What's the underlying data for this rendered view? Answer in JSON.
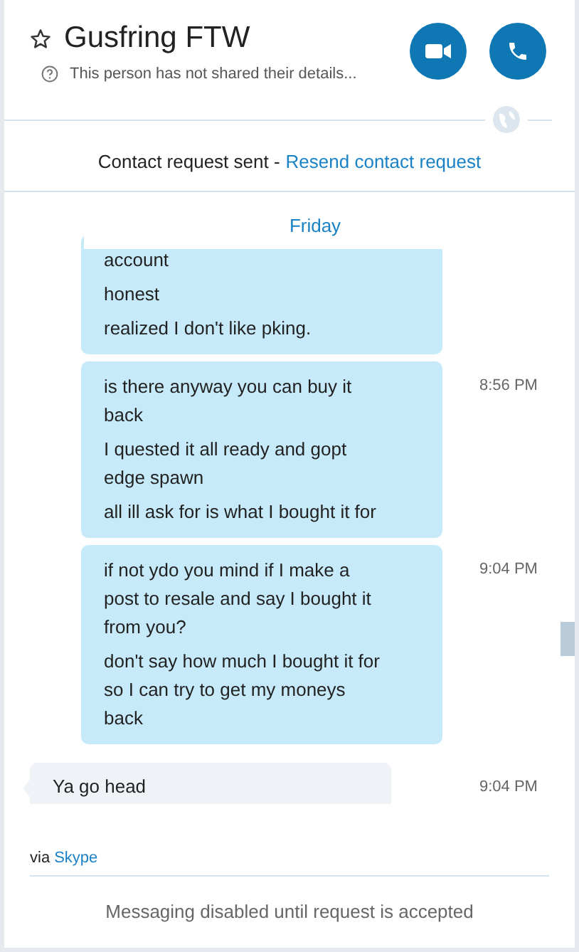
{
  "contact": {
    "name": "Gusfring FTW",
    "favorite": false,
    "status_text": "This person has not shared their details..."
  },
  "request_notice": {
    "text": "Contact request sent -",
    "link": "Resend contact request"
  },
  "day_label": "Friday",
  "message_groups": [
    {
      "kind": "outgoing",
      "messages": [
        "account",
        "honest",
        "realized I don't like pking."
      ]
    },
    {
      "kind": "outgoing",
      "time": "8:56 PM",
      "messages": [
        "is there anyway you can buy it back",
        "I quested it all ready and gopt edge spawn",
        "all ill ask for is what I bought it for"
      ]
    },
    {
      "kind": "outgoing",
      "time": "9:04 PM",
      "messages": [
        "if not ydo you mind if I make a post to resale and say I bought it from you?",
        "don't say how much I bought it for so I can try to get my moneys back"
      ]
    },
    {
      "kind": "incoming",
      "time": "9:04 PM",
      "messages": [
        "Ya go head"
      ]
    }
  ],
  "via": {
    "prefix": "via",
    "link": "Skype"
  },
  "footer": "Messaging disabled until request is accepted"
}
